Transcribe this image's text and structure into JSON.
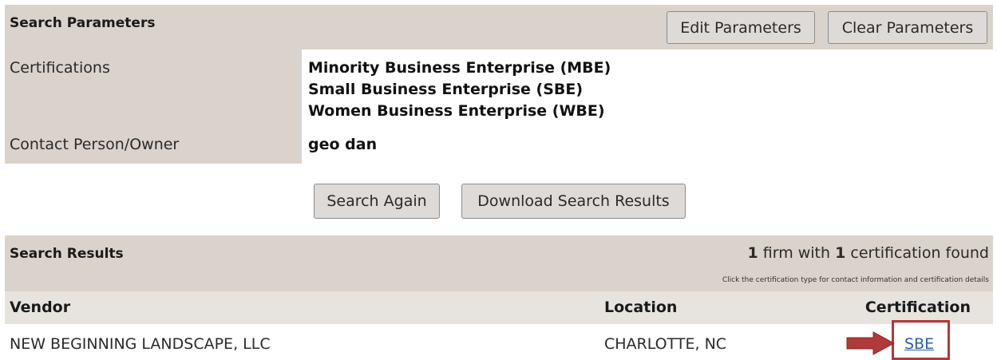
{
  "params": {
    "title": "Search Parameters",
    "edit_label": "Edit Parameters",
    "clear_label": "Clear Parameters",
    "rows": [
      {
        "label": "Certifications",
        "values": [
          "Minority Business Enterprise (MBE)",
          "Small Business Enterprise (SBE)",
          "Women Business Enterprise (WBE)"
        ]
      },
      {
        "label": "Contact Person/Owner",
        "values": [
          "geo dan"
        ]
      }
    ]
  },
  "actions": {
    "search_again": "Search Again",
    "download": "Download Search Results"
  },
  "results": {
    "title": "Search Results",
    "firm_count": "1",
    "firm_word": " firm with ",
    "cert_count": "1",
    "cert_word": " certification found",
    "hint": "Click the certification type for contact information and certification details",
    "columns": {
      "vendor": "Vendor",
      "location": "Location",
      "certification": "Certification"
    },
    "rows": [
      {
        "vendor": "NEW BEGINNING LANDSCAPE, LLC",
        "location": "CHARLOTTE, NC",
        "certification": "SBE"
      }
    ]
  },
  "colors": {
    "header_bg": "#d9d3cb",
    "link": "#2a5db0",
    "highlight": "#b03a3a"
  }
}
